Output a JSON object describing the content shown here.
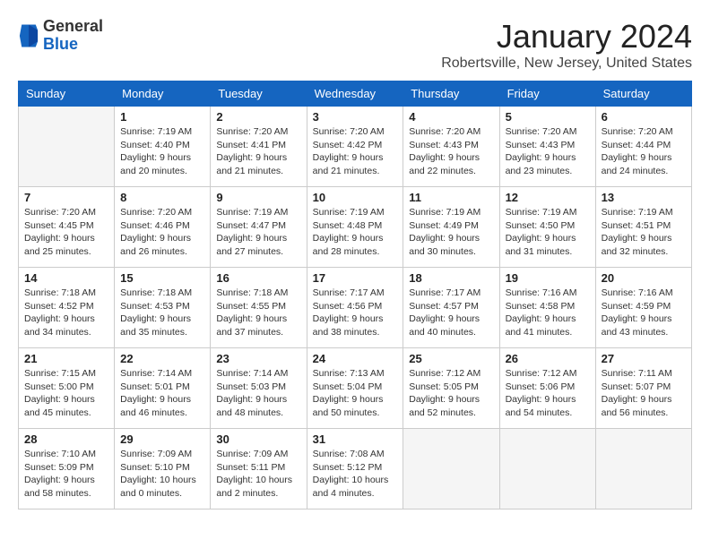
{
  "header": {
    "logo": {
      "line1": "General",
      "line2": "Blue"
    },
    "month": "January 2024",
    "location": "Robertsville, New Jersey, United States"
  },
  "days_of_week": [
    "Sunday",
    "Monday",
    "Tuesday",
    "Wednesday",
    "Thursday",
    "Friday",
    "Saturday"
  ],
  "weeks": [
    [
      {
        "day": "",
        "info": ""
      },
      {
        "day": "1",
        "info": "Sunrise: 7:19 AM\nSunset: 4:40 PM\nDaylight: 9 hours\nand 20 minutes."
      },
      {
        "day": "2",
        "info": "Sunrise: 7:20 AM\nSunset: 4:41 PM\nDaylight: 9 hours\nand 21 minutes."
      },
      {
        "day": "3",
        "info": "Sunrise: 7:20 AM\nSunset: 4:42 PM\nDaylight: 9 hours\nand 21 minutes."
      },
      {
        "day": "4",
        "info": "Sunrise: 7:20 AM\nSunset: 4:43 PM\nDaylight: 9 hours\nand 22 minutes."
      },
      {
        "day": "5",
        "info": "Sunrise: 7:20 AM\nSunset: 4:43 PM\nDaylight: 9 hours\nand 23 minutes."
      },
      {
        "day": "6",
        "info": "Sunrise: 7:20 AM\nSunset: 4:44 PM\nDaylight: 9 hours\nand 24 minutes."
      }
    ],
    [
      {
        "day": "7",
        "info": "Sunrise: 7:20 AM\nSunset: 4:45 PM\nDaylight: 9 hours\nand 25 minutes."
      },
      {
        "day": "8",
        "info": "Sunrise: 7:20 AM\nSunset: 4:46 PM\nDaylight: 9 hours\nand 26 minutes."
      },
      {
        "day": "9",
        "info": "Sunrise: 7:19 AM\nSunset: 4:47 PM\nDaylight: 9 hours\nand 27 minutes."
      },
      {
        "day": "10",
        "info": "Sunrise: 7:19 AM\nSunset: 4:48 PM\nDaylight: 9 hours\nand 28 minutes."
      },
      {
        "day": "11",
        "info": "Sunrise: 7:19 AM\nSunset: 4:49 PM\nDaylight: 9 hours\nand 30 minutes."
      },
      {
        "day": "12",
        "info": "Sunrise: 7:19 AM\nSunset: 4:50 PM\nDaylight: 9 hours\nand 31 minutes."
      },
      {
        "day": "13",
        "info": "Sunrise: 7:19 AM\nSunset: 4:51 PM\nDaylight: 9 hours\nand 32 minutes."
      }
    ],
    [
      {
        "day": "14",
        "info": "Sunrise: 7:18 AM\nSunset: 4:52 PM\nDaylight: 9 hours\nand 34 minutes."
      },
      {
        "day": "15",
        "info": "Sunrise: 7:18 AM\nSunset: 4:53 PM\nDaylight: 9 hours\nand 35 minutes."
      },
      {
        "day": "16",
        "info": "Sunrise: 7:18 AM\nSunset: 4:55 PM\nDaylight: 9 hours\nand 37 minutes."
      },
      {
        "day": "17",
        "info": "Sunrise: 7:17 AM\nSunset: 4:56 PM\nDaylight: 9 hours\nand 38 minutes."
      },
      {
        "day": "18",
        "info": "Sunrise: 7:17 AM\nSunset: 4:57 PM\nDaylight: 9 hours\nand 40 minutes."
      },
      {
        "day": "19",
        "info": "Sunrise: 7:16 AM\nSunset: 4:58 PM\nDaylight: 9 hours\nand 41 minutes."
      },
      {
        "day": "20",
        "info": "Sunrise: 7:16 AM\nSunset: 4:59 PM\nDaylight: 9 hours\nand 43 minutes."
      }
    ],
    [
      {
        "day": "21",
        "info": "Sunrise: 7:15 AM\nSunset: 5:00 PM\nDaylight: 9 hours\nand 45 minutes."
      },
      {
        "day": "22",
        "info": "Sunrise: 7:14 AM\nSunset: 5:01 PM\nDaylight: 9 hours\nand 46 minutes."
      },
      {
        "day": "23",
        "info": "Sunrise: 7:14 AM\nSunset: 5:03 PM\nDaylight: 9 hours\nand 48 minutes."
      },
      {
        "day": "24",
        "info": "Sunrise: 7:13 AM\nSunset: 5:04 PM\nDaylight: 9 hours\nand 50 minutes."
      },
      {
        "day": "25",
        "info": "Sunrise: 7:12 AM\nSunset: 5:05 PM\nDaylight: 9 hours\nand 52 minutes."
      },
      {
        "day": "26",
        "info": "Sunrise: 7:12 AM\nSunset: 5:06 PM\nDaylight: 9 hours\nand 54 minutes."
      },
      {
        "day": "27",
        "info": "Sunrise: 7:11 AM\nSunset: 5:07 PM\nDaylight: 9 hours\nand 56 minutes."
      }
    ],
    [
      {
        "day": "28",
        "info": "Sunrise: 7:10 AM\nSunset: 5:09 PM\nDaylight: 9 hours\nand 58 minutes."
      },
      {
        "day": "29",
        "info": "Sunrise: 7:09 AM\nSunset: 5:10 PM\nDaylight: 10 hours\nand 0 minutes."
      },
      {
        "day": "30",
        "info": "Sunrise: 7:09 AM\nSunset: 5:11 PM\nDaylight: 10 hours\nand 2 minutes."
      },
      {
        "day": "31",
        "info": "Sunrise: 7:08 AM\nSunset: 5:12 PM\nDaylight: 10 hours\nand 4 minutes."
      },
      {
        "day": "",
        "info": ""
      },
      {
        "day": "",
        "info": ""
      },
      {
        "day": "",
        "info": ""
      }
    ]
  ]
}
